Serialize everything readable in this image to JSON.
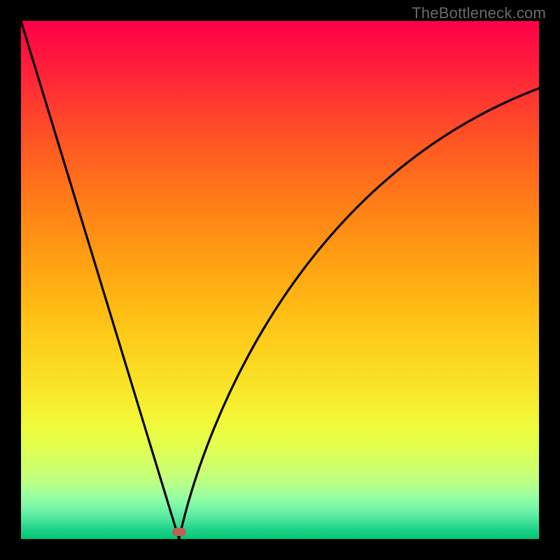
{
  "watermark": "TheBottleneck.com",
  "chart_data": {
    "type": "line",
    "title": "",
    "xlabel": "",
    "ylabel": "",
    "xlim": [
      0,
      1
    ],
    "ylim": [
      0,
      1
    ],
    "grid": false,
    "background": "rainbow-gradient-vertical",
    "series": [
      {
        "name": "left-branch",
        "x": [
          0.0,
          0.04,
          0.08,
          0.12,
          0.16,
          0.2,
          0.24,
          0.28,
          0.305
        ],
        "y": [
          1.0,
          0.87,
          0.74,
          0.61,
          0.48,
          0.35,
          0.22,
          0.09,
          0.0
        ]
      },
      {
        "name": "right-branch",
        "x": [
          0.305,
          0.33,
          0.36,
          0.4,
          0.45,
          0.5,
          0.56,
          0.62,
          0.68,
          0.75,
          0.82,
          0.9,
          1.0
        ],
        "y": [
          0.0,
          0.1,
          0.2,
          0.31,
          0.42,
          0.51,
          0.59,
          0.66,
          0.72,
          0.77,
          0.81,
          0.84,
          0.87
        ]
      }
    ],
    "minimum_point": {
      "x": 0.305,
      "y": 0.0
    },
    "minimum_marker_color": "#b96254",
    "curve_color": "#000000",
    "gradient_stops": [
      {
        "pos": 0.0,
        "color": "#ff004a"
      },
      {
        "pos": 0.5,
        "color": "#ffb014"
      },
      {
        "pos": 0.78,
        "color": "#f0fa3b"
      },
      {
        "pos": 1.0,
        "color": "#00c874"
      }
    ]
  }
}
